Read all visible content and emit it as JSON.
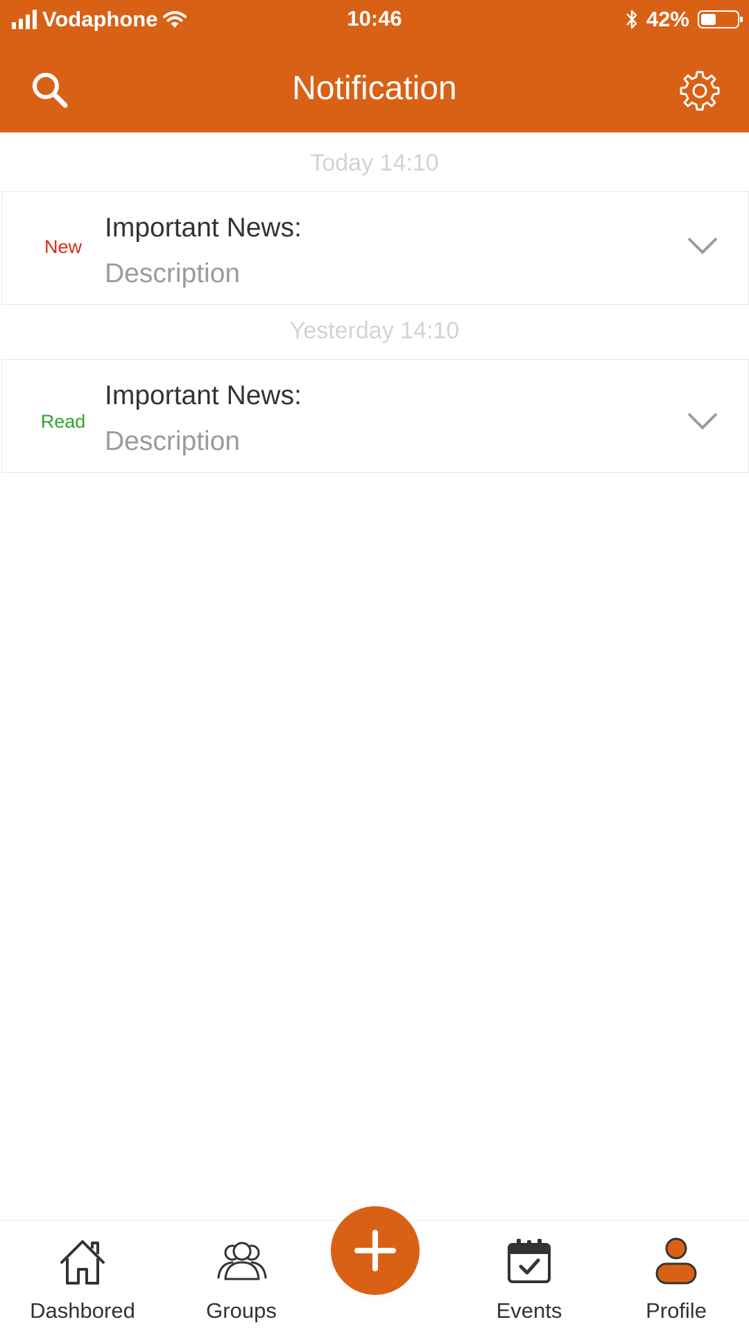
{
  "status_bar": {
    "carrier": "Vodaphone",
    "time": "10:46",
    "battery_percent": "42%",
    "battery_level": 0.42,
    "icons": [
      "signal-icon",
      "wifi-icon",
      "bluetooth-icon",
      "battery-icon"
    ]
  },
  "header": {
    "title": "Notification",
    "search_icon": "search-icon",
    "settings_icon": "gear-icon"
  },
  "notifications": [
    {
      "date": "Today 14:10",
      "status": "New",
      "status_color": "#D62C1A",
      "title": "Important News:",
      "description": "Description"
    },
    {
      "date": "Yesterday 14:10",
      "status": "Read",
      "status_color": "#2AA52A",
      "title": "Important News:",
      "description": "Description"
    }
  ],
  "bottom_nav": {
    "items": [
      {
        "label": "Dashbored",
        "icon": "home-icon"
      },
      {
        "label": "Groups",
        "icon": "groups-icon"
      },
      {
        "label": "Events",
        "icon": "calendar-check-icon"
      },
      {
        "label": "Profile",
        "icon": "profile-icon"
      }
    ],
    "fab_icon": "plus-icon"
  },
  "colors": {
    "accent": "#D96116",
    "date_text": "#D3D3D3",
    "title_text": "#333333",
    "description_text": "#9B9B9B"
  }
}
